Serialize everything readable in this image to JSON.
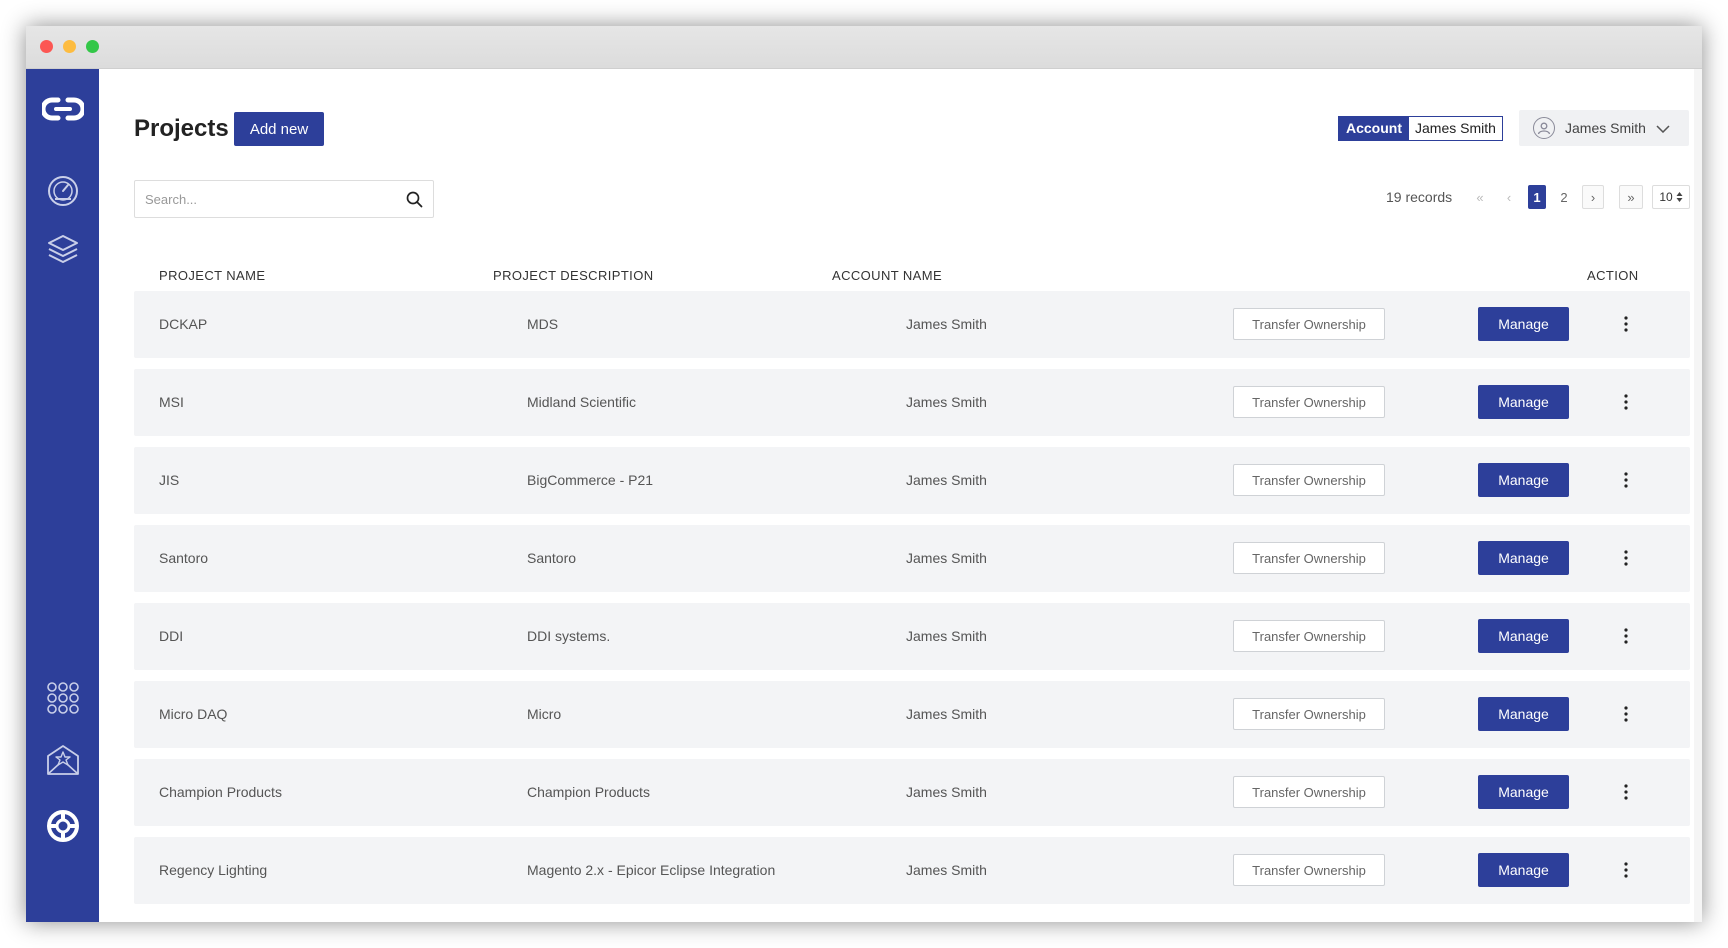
{
  "header": {
    "title": "Projects",
    "add_new_label": "Add new",
    "account_tag": {
      "label": "Account",
      "value": "James Smith"
    },
    "user": {
      "name": "James Smith"
    }
  },
  "search": {
    "placeholder": "Search..."
  },
  "pagination": {
    "records_text": "19 records",
    "first": "«",
    "prev": "‹",
    "pages": [
      "1",
      "2"
    ],
    "current_page": "1",
    "next": "›",
    "last": "»",
    "per_page": "10"
  },
  "table": {
    "columns": [
      "PROJECT NAME",
      "PROJECT DESCRIPTION",
      "ACCOUNT NAME",
      "ACTION"
    ],
    "transfer_label": "Transfer Ownership",
    "manage_label": "Manage",
    "rows": [
      {
        "name": "DCKAP",
        "description": "MDS",
        "account": "James Smith"
      },
      {
        "name": "MSI",
        "description": "Midland Scientific",
        "account": "James Smith"
      },
      {
        "name": "JIS",
        "description": "BigCommerce - P21",
        "account": "James Smith"
      },
      {
        "name": "Santoro",
        "description": "Santoro",
        "account": "James Smith"
      },
      {
        "name": "DDI",
        "description": "DDI systems.",
        "account": "James Smith"
      },
      {
        "name": "Micro DAQ",
        "description": "Micro",
        "account": "James Smith"
      },
      {
        "name": "Champion Products",
        "description": "Champion Products",
        "account": "James Smith"
      },
      {
        "name": "Regency Lighting",
        "description": "Magento 2.x - Epicor Eclipse Integration",
        "account": "James Smith"
      }
    ]
  },
  "sidebar": {
    "icons": [
      "logo-icon",
      "dashboard-icon",
      "layers-icon",
      "apps-grid-icon",
      "mail-star-icon",
      "support-lifebuoy-icon"
    ]
  },
  "colors": {
    "brand": "#2d3f9a",
    "row_bg": "#f3f4f6"
  }
}
